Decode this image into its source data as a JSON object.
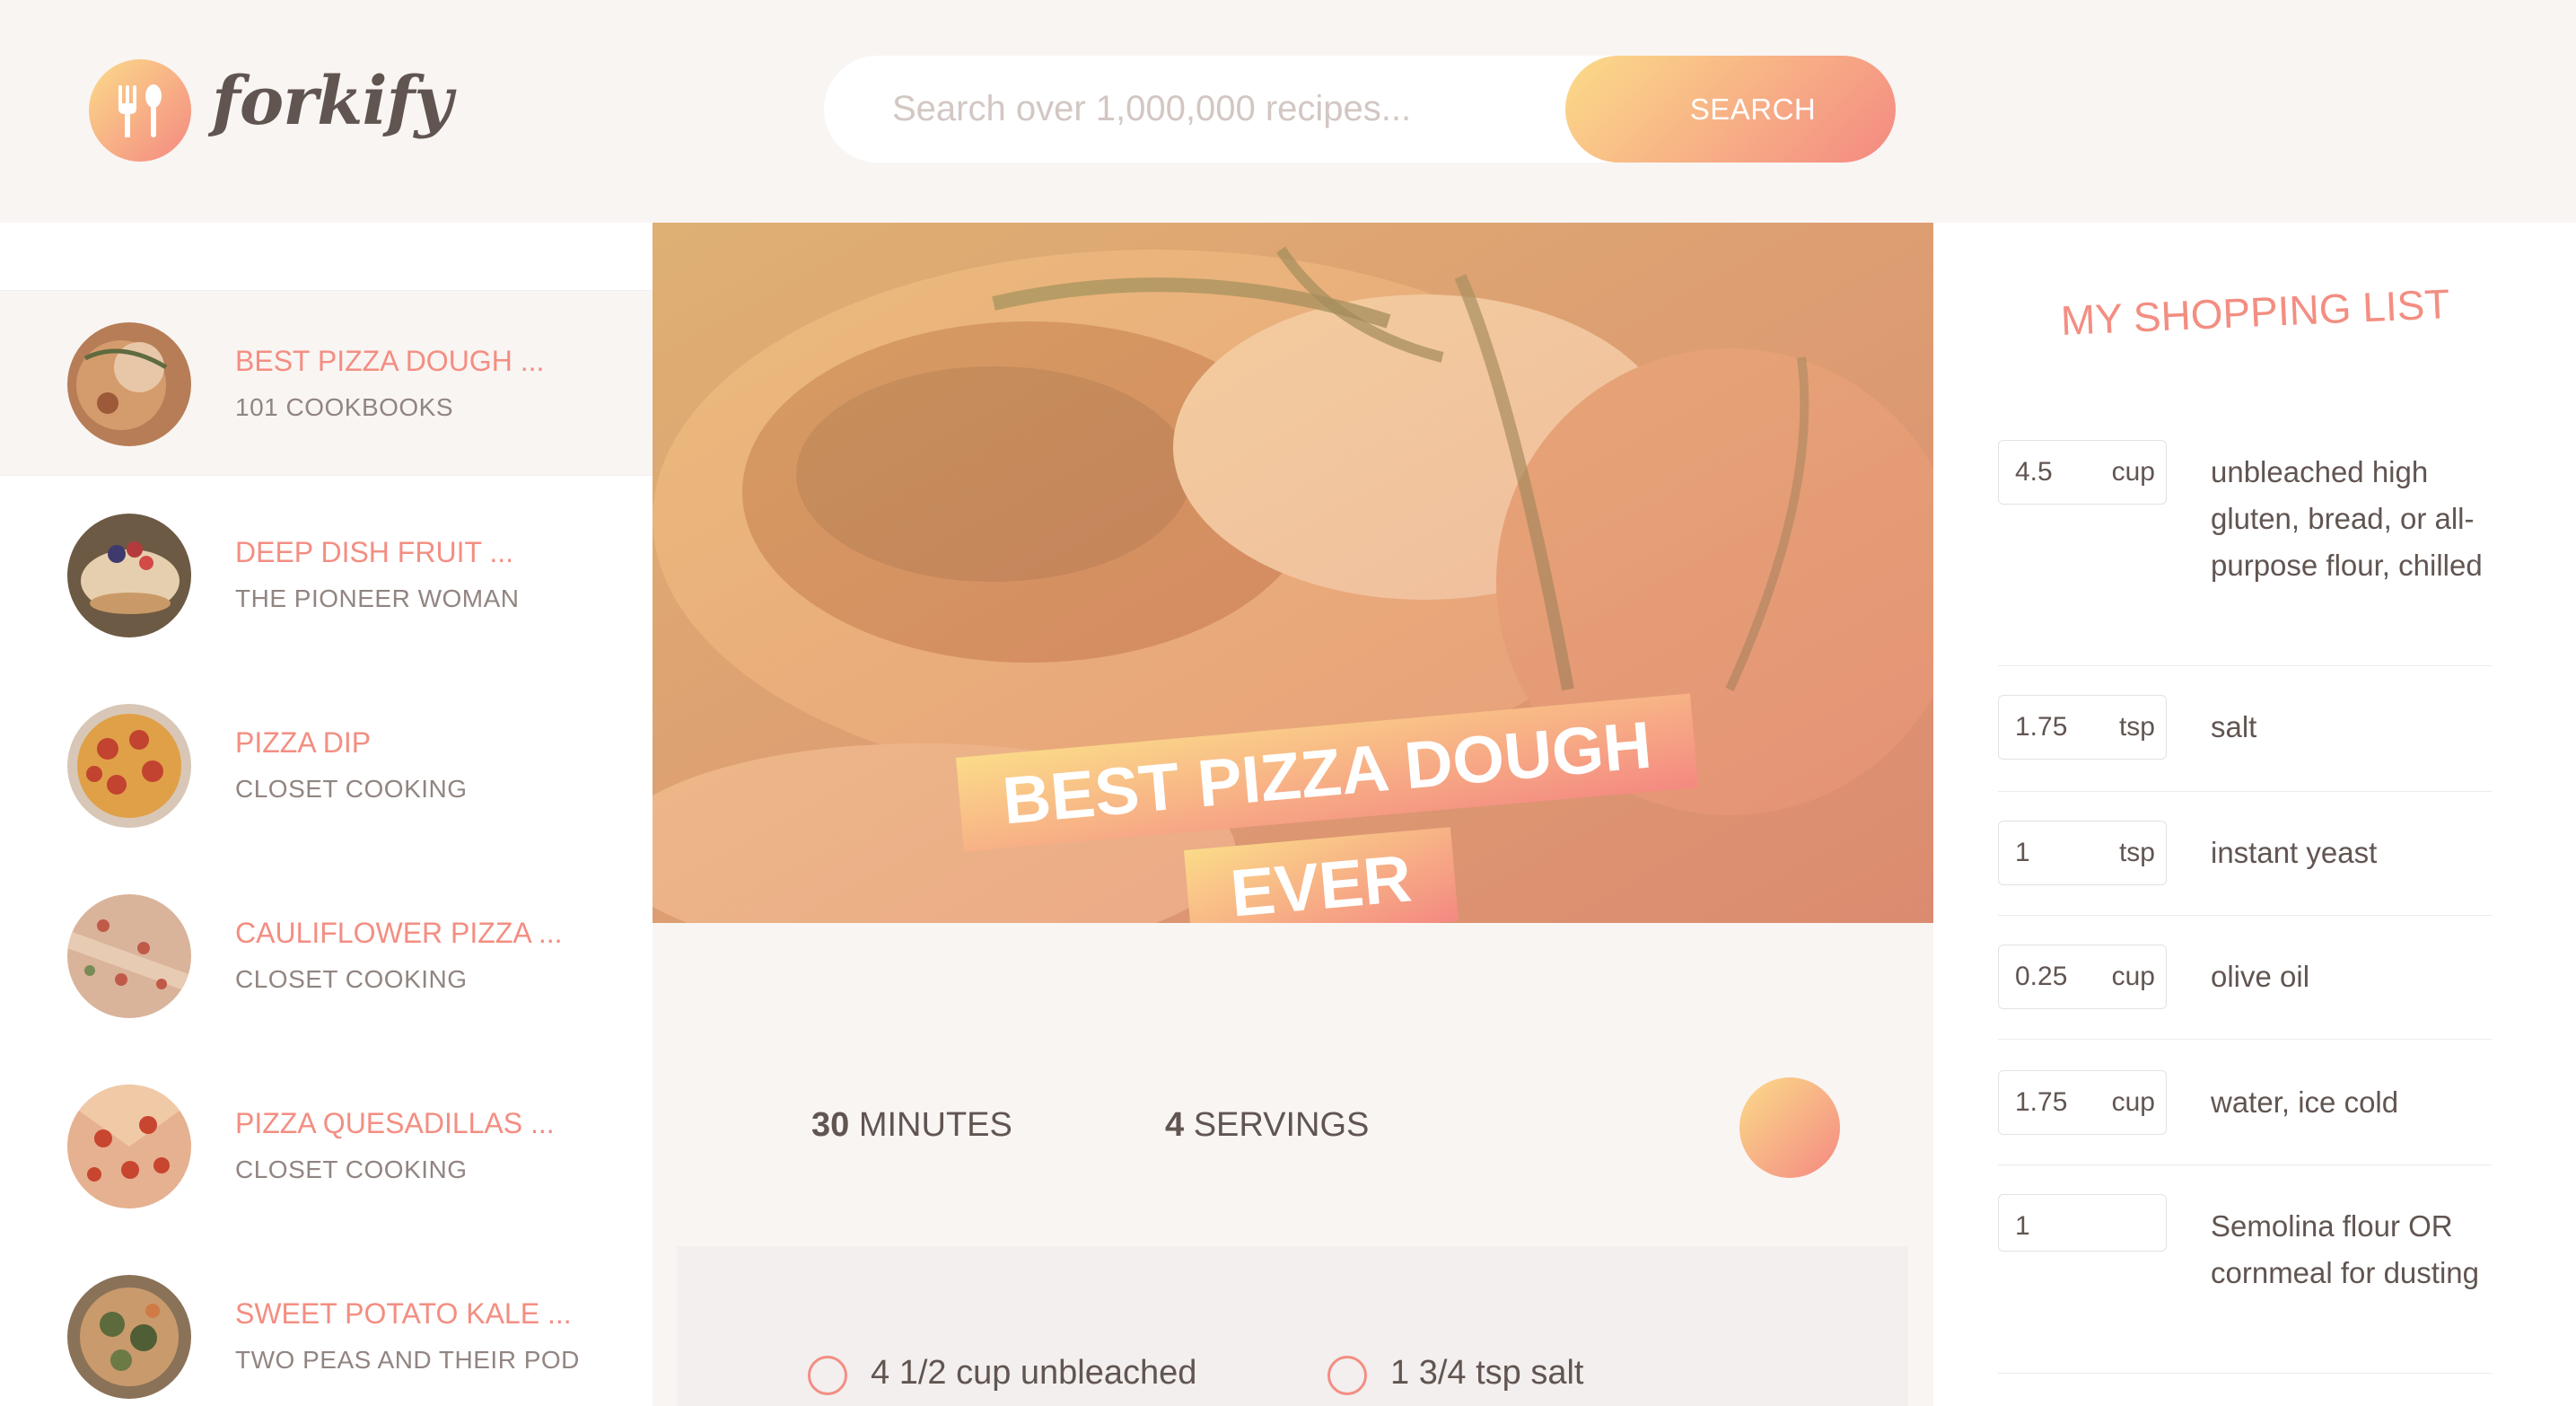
{
  "header": {
    "logo_text": "forkify",
    "search": {
      "placeholder": "Search over 1,000,000 recipes...",
      "value": ""
    },
    "search_button_label": "SEARCH"
  },
  "results": [
    {
      "name": "BEST PIZZA DOUGH ...",
      "author": "101 COOKBOOKS",
      "active": true
    },
    {
      "name": "DEEP DISH FRUIT ...",
      "author": "THE PIONEER WOMAN",
      "active": false
    },
    {
      "name": "PIZZA DIP",
      "author": "CLOSET COOKING",
      "active": false
    },
    {
      "name": "CAULIFLOWER PIZZA ...",
      "author": "CLOSET COOKING",
      "active": false
    },
    {
      "name": "PIZZA QUESADILLAS ...",
      "author": "CLOSET COOKING",
      "active": false
    },
    {
      "name": "SWEET POTATO KALE ...",
      "author": "TWO PEAS AND THEIR POD",
      "active": false
    }
  ],
  "recipe": {
    "title_line1": "BEST PIZZA DOUGH",
    "title_line2": "EVER",
    "minutes": "30",
    "minutes_label": "MINUTES",
    "servings": "4",
    "servings_label": "SERVINGS",
    "ingredients_visible": [
      "4 1/2 cup unbleached",
      "1 3/4 tsp salt"
    ]
  },
  "shopping_list": {
    "title": "MY SHOPPING LIST",
    "items": [
      {
        "count": "4.5",
        "unit": "cup",
        "desc": "unbleached high gluten, bread, or all-purpose flour, chilled"
      },
      {
        "count": "1.75",
        "unit": "tsp",
        "desc": "salt"
      },
      {
        "count": "1",
        "unit": "tsp",
        "desc": "instant yeast"
      },
      {
        "count": "0.25",
        "unit": "cup",
        "desc": "olive oil"
      },
      {
        "count": "1.75",
        "unit": "cup",
        "desc": "water, ice cold"
      },
      {
        "count": "1",
        "unit": "",
        "desc": "Semolina flour OR cornmeal for dusting"
      }
    ]
  },
  "colors": {
    "accent": "#f38e82",
    "gradient_start": "#fbdb89",
    "gradient_end": "#f48982",
    "text": "#615551",
    "background": "#f9f5f3"
  }
}
